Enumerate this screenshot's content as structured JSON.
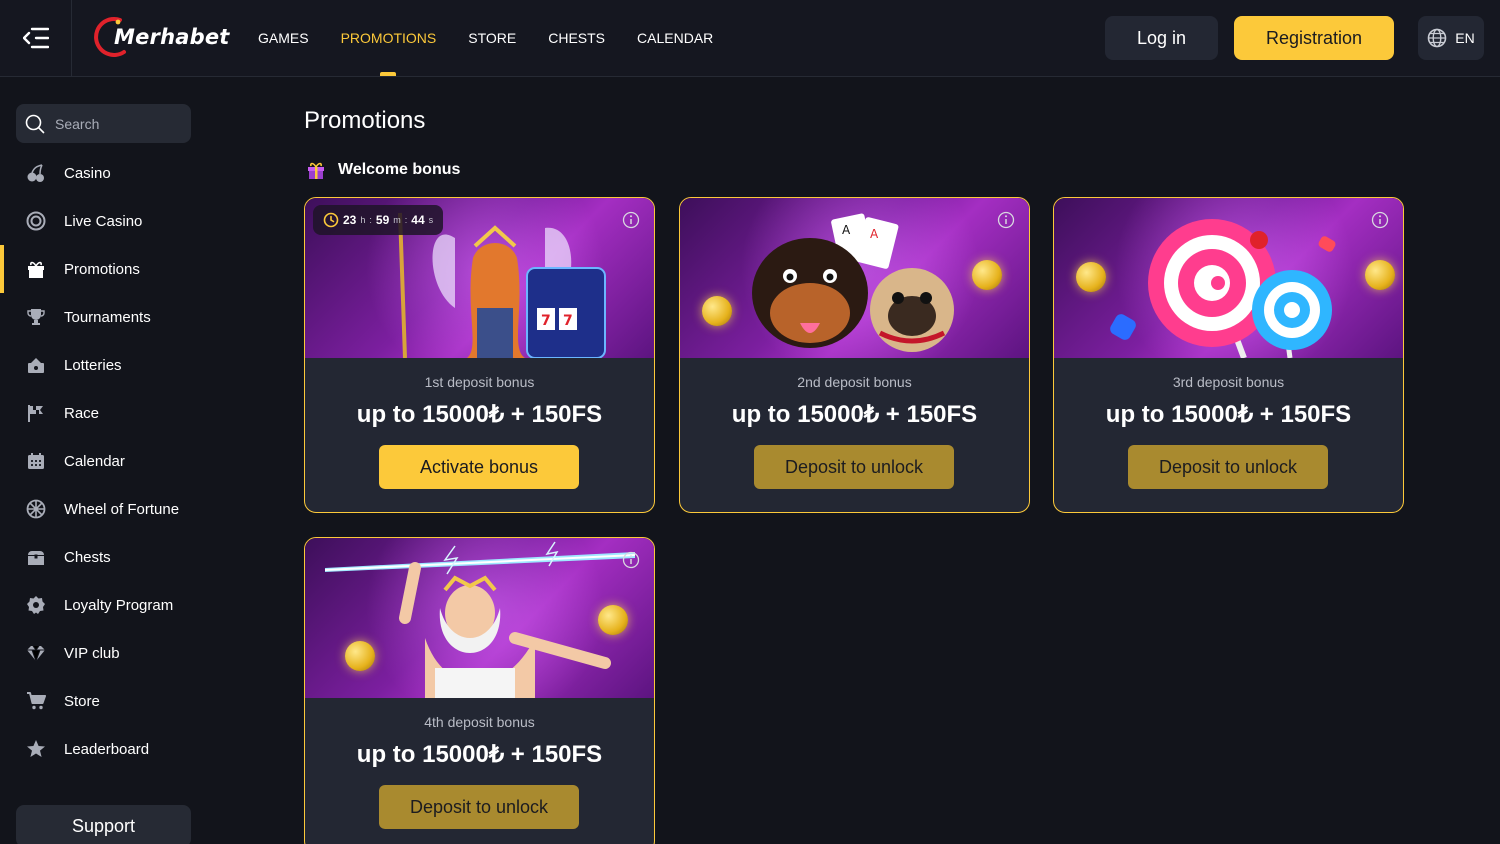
{
  "header": {
    "logo_text": "Merhabet",
    "nav": [
      "GAMES",
      "PROMOTIONS",
      "STORE",
      "CHESTS",
      "CALENDAR"
    ],
    "active_nav": "PROMOTIONS",
    "login_label": "Log in",
    "register_label": "Registration",
    "language": "EN"
  },
  "sidebar": {
    "search_placeholder": "Search",
    "items": [
      {
        "label": "Casino",
        "icon": "cherries-icon"
      },
      {
        "label": "Live Casino",
        "icon": "chip-icon"
      },
      {
        "label": "Promotions",
        "icon": "gift-icon"
      },
      {
        "label": "Tournaments",
        "icon": "trophy-icon"
      },
      {
        "label": "Lotteries",
        "icon": "lottery-icon"
      },
      {
        "label": "Race",
        "icon": "flag-icon"
      },
      {
        "label": "Calendar",
        "icon": "calendar-icon"
      },
      {
        "label": "Wheel of Fortune",
        "icon": "wheel-icon"
      },
      {
        "label": "Chests",
        "icon": "chest-icon"
      },
      {
        "label": "Loyalty Program",
        "icon": "badge-icon"
      },
      {
        "label": "VIP club",
        "icon": "diamond-icon"
      },
      {
        "label": "Store",
        "icon": "cart-icon"
      },
      {
        "label": "Leaderboard",
        "icon": "star-icon"
      }
    ],
    "active_item": "Promotions",
    "support_label": "Support"
  },
  "main": {
    "title": "Promotions",
    "section_title": "Welcome bonus",
    "timer": {
      "hours": "23",
      "h": "h",
      "minutes": "59",
      "m": "m",
      "seconds": "44",
      "s": "s"
    },
    "cards": [
      {
        "subtitle": "1st deposit bonus",
        "amount": "up to 15000₺ + 150FS",
        "button": "Activate bonus"
      },
      {
        "subtitle": "2nd deposit bonus",
        "amount": "up to 15000₺ + 150FS",
        "button": "Deposit to unlock"
      },
      {
        "subtitle": "3rd deposit bonus",
        "amount": "up to 15000₺ + 150FS",
        "button": "Deposit to unlock"
      },
      {
        "subtitle": "4th deposit bonus",
        "amount": "up to 15000₺ + 150FS",
        "button": "Deposit to unlock"
      }
    ]
  },
  "colors": {
    "accent": "#fcc93a",
    "background": "#12141b",
    "card": "#232733",
    "locked_button": "#a98a2f"
  }
}
